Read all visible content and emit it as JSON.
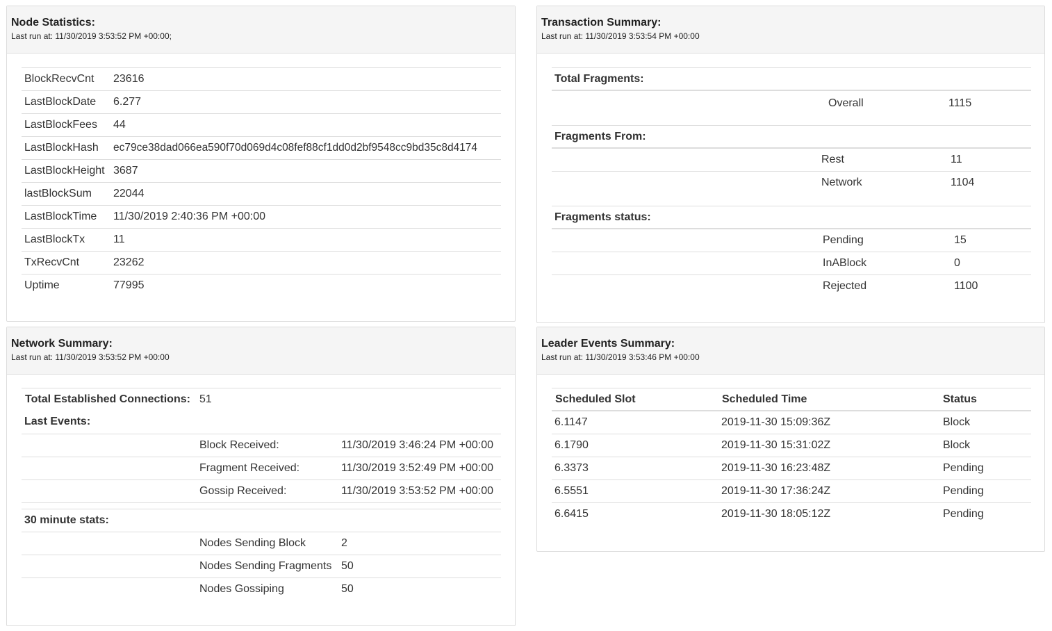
{
  "node_stats": {
    "title": "Node Statistics:",
    "subtitle": "Last run at: 11/30/2019 3:53:52 PM +00:00;",
    "rows": [
      {
        "key": "BlockRecvCnt",
        "value": "23616"
      },
      {
        "key": "LastBlockDate",
        "value": "6.277"
      },
      {
        "key": "LastBlockFees",
        "value": "44"
      },
      {
        "key": "LastBlockHash",
        "value": "ec79ce38dad066ea590f70d069d4c08fef88cf1dd0d2bf9548cc9bd35c8d4174"
      },
      {
        "key": "LastBlockHeight",
        "value": "3687"
      },
      {
        "key": "lastBlockSum",
        "value": "22044"
      },
      {
        "key": "LastBlockTime",
        "value": "11/30/2019 2:40:36 PM +00:00"
      },
      {
        "key": "LastBlockTx",
        "value": "11"
      },
      {
        "key": "TxRecvCnt",
        "value": "23262"
      },
      {
        "key": "Uptime",
        "value": "77995"
      }
    ]
  },
  "tx_summary": {
    "title": "Transaction Summary:",
    "subtitle": "Last run at: 11/30/2019 3:53:54 PM +00:00",
    "total_label": "Total Fragments:",
    "overall": {
      "label": "Overall",
      "value": "1115"
    },
    "from_label": "Fragments From:",
    "from_rows": [
      {
        "label": "Rest",
        "value": "11"
      },
      {
        "label": "Network",
        "value": "1104"
      }
    ],
    "status_label": "Fragments status:",
    "status_rows": [
      {
        "label": "Pending",
        "value": "15"
      },
      {
        "label": "InABlock",
        "value": "0"
      },
      {
        "label": "Rejected",
        "value": "1100"
      }
    ]
  },
  "network_summary": {
    "title": "Network Summary:",
    "subtitle": "Last run at: 11/30/2019 3:53:52 PM +00:00",
    "total_label": "Total Established Connections:",
    "total_value": "51",
    "last_events_label": "Last Events:",
    "events": [
      {
        "label": "Block Received:",
        "value": "11/30/2019 3:46:24 PM +00:00"
      },
      {
        "label": "Fragment Received:",
        "value": "11/30/2019 3:52:49 PM +00:00"
      },
      {
        "label": "Gossip Received:",
        "value": "11/30/2019 3:53:52 PM +00:00"
      }
    ],
    "stats_label": "30 minute stats:",
    "stats": [
      {
        "label": "Nodes Sending Block",
        "value": "2"
      },
      {
        "label": "Nodes Sending Fragments",
        "value": "50"
      },
      {
        "label": "Nodes Gossiping",
        "value": "50"
      }
    ]
  },
  "leader_events": {
    "title": "Leader Events Summary:",
    "subtitle": "Last run at: 11/30/2019 3:53:46 PM +00:00",
    "headers": {
      "slot": "Scheduled Slot",
      "time": "Scheduled Time",
      "status": "Status"
    },
    "rows": [
      {
        "slot": "6.1147",
        "time": "2019-11-30 15:09:36Z",
        "status": "Block"
      },
      {
        "slot": "6.1790",
        "time": "2019-11-30 15:31:02Z",
        "status": "Block"
      },
      {
        "slot": "6.3373",
        "time": "2019-11-30 16:23:48Z",
        "status": "Pending"
      },
      {
        "slot": "6.5551",
        "time": "2019-11-30 17:36:24Z",
        "status": "Pending"
      },
      {
        "slot": "6.6415",
        "time": "2019-11-30 18:05:12Z",
        "status": "Pending"
      }
    ]
  }
}
